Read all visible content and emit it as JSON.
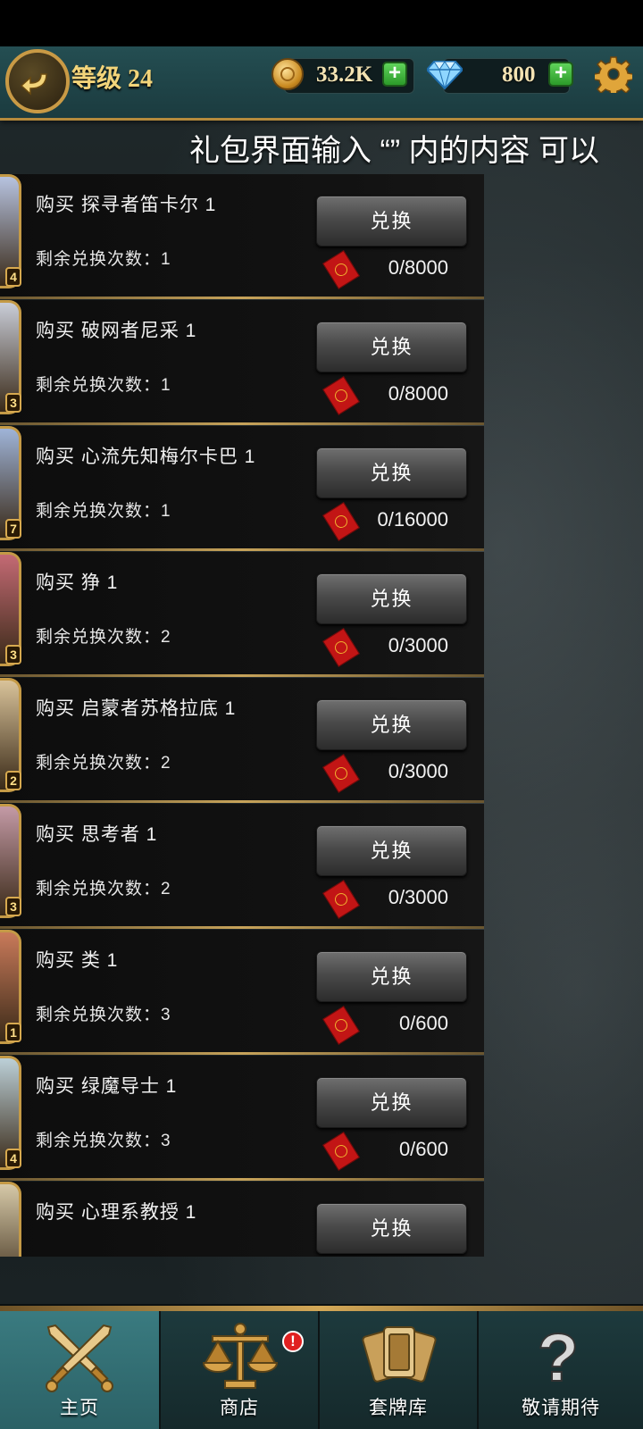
{
  "header": {
    "level_label": "等级 24",
    "coins": "33.2K",
    "gems": "800",
    "marquee": "礼包界面输入 “” 内的内容 可以"
  },
  "items": [
    {
      "title": "购买 探寻者笛卡尔 1",
      "remaining": "剩余兑换次数：1",
      "button": "兑换",
      "cost": "0/8000",
      "star": "4",
      "portrait_color": "#b7c3e0"
    },
    {
      "title": "购买 破网者尼采 1",
      "remaining": "剩余兑换次数：1",
      "button": "兑换",
      "cost": "0/8000",
      "star": "3",
      "portrait_color": "#c9cdd8"
    },
    {
      "title": "购买 心流先知梅尔卡巴 1",
      "remaining": "剩余兑换次数：1",
      "button": "兑换",
      "cost": "0/16000",
      "star": "7",
      "portrait_color": "#9fb4d8"
    },
    {
      "title": "购买 狰 1",
      "remaining": "剩余兑换次数：2",
      "button": "兑换",
      "cost": "0/3000",
      "star": "3",
      "portrait_color": "#c46a74"
    },
    {
      "title": "购买 启蒙者苏格拉底 1",
      "remaining": "剩余兑换次数：2",
      "button": "兑换",
      "cost": "0/3000",
      "star": "2",
      "portrait_color": "#d9c39a"
    },
    {
      "title": "购买 思考者 1",
      "remaining": "剩余兑换次数：2",
      "button": "兑换",
      "cost": "0/3000",
      "star": "3",
      "portrait_color": "#c49aa6"
    },
    {
      "title": "购买 类 1",
      "remaining": "剩余兑换次数：3",
      "button": "兑换",
      "cost": "0/600",
      "star": "1",
      "portrait_color": "#c97a5a"
    },
    {
      "title": "购买 绿魔导士 1",
      "remaining": "剩余兑换次数：3",
      "button": "兑换",
      "cost": "0/600",
      "star": "4",
      "portrait_color": "#bcd0d8"
    },
    {
      "title": "购买 心理系教授 1",
      "remaining": "",
      "button": "兑换",
      "cost": "",
      "star": "",
      "portrait_color": "#d6c9a8"
    }
  ],
  "nav": [
    {
      "label": "主页",
      "icon": "crossed-swords-icon",
      "active": true
    },
    {
      "label": "商店",
      "icon": "scales-icon",
      "active": false,
      "badge": "!"
    },
    {
      "label": "套牌库",
      "icon": "cards-icon",
      "active": false
    },
    {
      "label": "敬请期待",
      "icon": "question-icon",
      "active": false
    }
  ]
}
